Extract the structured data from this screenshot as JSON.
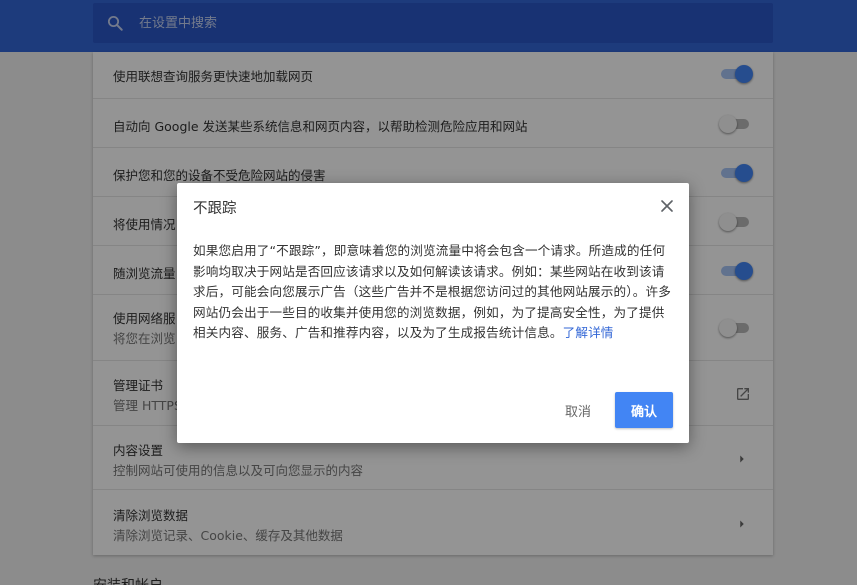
{
  "search": {
    "placeholder": "在设置中搜索"
  },
  "settings": {
    "rows": [
      {
        "title": "使用联想查询服务更快速地加载网页"
      },
      {
        "title": "自动向 Google 发送某些系统信息和网页内容，以帮助检测危险应用和网站"
      },
      {
        "title": "保护您和您的设备不受危险网站的侵害"
      },
      {
        "title": "将使用情况"
      },
      {
        "title": "随浏览流量"
      },
      {
        "title": "使用网络服",
        "subtitle": "将您在浏览"
      },
      {
        "title": "管理证书",
        "subtitle": "管理 HTTPS"
      },
      {
        "title": "内容设置",
        "subtitle": "控制网站可使用的信息以及可向您显示的内容"
      },
      {
        "title": "清除浏览数据",
        "subtitle": "清除浏览记录、Cookie、缓存及其他数据"
      }
    ],
    "toggles": [
      true,
      false,
      true,
      false,
      true,
      false
    ],
    "next_section_title": "安装和帐户"
  },
  "dialog": {
    "title": "不跟踪",
    "body": "如果您启用了“不跟踪”，即意味着您的浏览流量中将会包含一个请求。所造成的任何影响均取决于网站是否回应该请求以及如何解读该请求。例如：某些网站在收到该请求后，可能会向您展示广告（这些广告并不是根据您访问过的其他网站展示的）。许多网站仍会出于一些目的收集并使用您的浏览数据，例如，为了提高安全性，为了提供相关内容、服务、广告和推荐内容，以及为了生成报告统计信息。",
    "learn_more_link": "了解详情",
    "cancel_label": "取消",
    "confirm_label": "确认"
  },
  "colors": {
    "header": "#3367d6",
    "search_box": "#2a56c6",
    "accent": "#4285f4",
    "link": "#3367d6"
  },
  "icons": [
    "search-icon",
    "close-icon",
    "external-link-icon",
    "chevron-right-icon"
  ]
}
